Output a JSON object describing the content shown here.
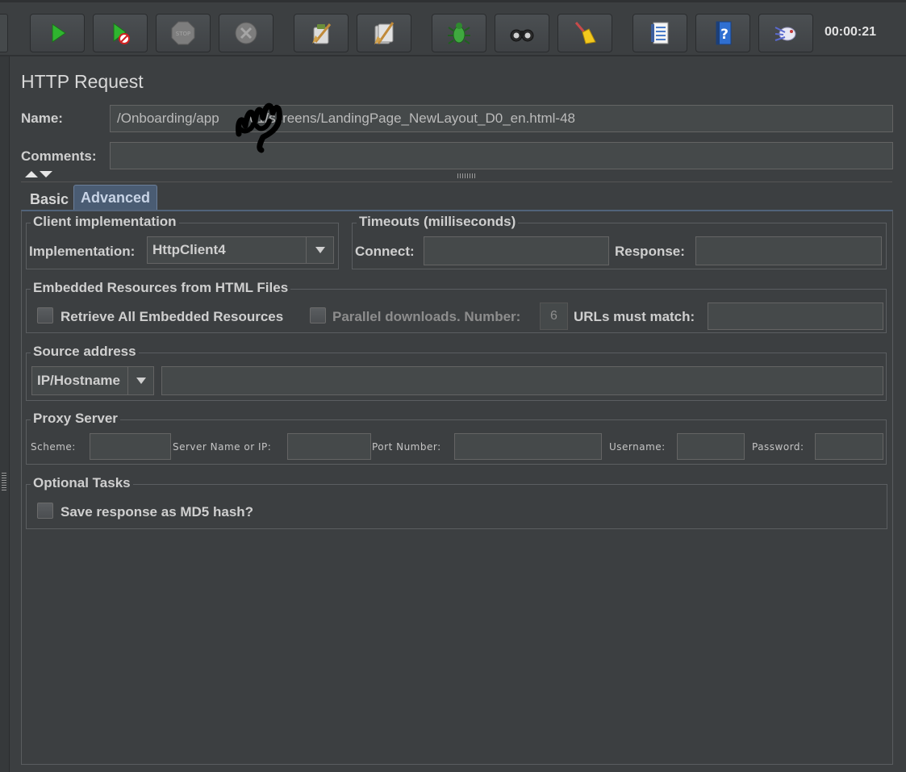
{
  "toolbar": {
    "buttons": [
      {
        "name": "start-icon"
      },
      {
        "name": "start-no-pauses-icon"
      },
      {
        "name": "stop-icon"
      },
      {
        "name": "shutdown-icon"
      },
      {
        "name": "clear-icon"
      },
      {
        "name": "clear-all-icon"
      },
      {
        "name": "bug-icon"
      },
      {
        "name": "binoculars-icon"
      },
      {
        "name": "broom-icon"
      },
      {
        "name": "function-helper-icon"
      },
      {
        "name": "help-icon"
      },
      {
        "name": "remote-icon"
      }
    ],
    "timer": "00:00:21"
  },
  "panel": {
    "title": "HTTP Request",
    "name_label": "Name:",
    "name_value": "/Onboarding/app        01/screens/LandingPage_NewLayout_D0_en.html-48",
    "comments_label": "Comments:",
    "comments_value": ""
  },
  "tabs": [
    {
      "label": "Basic",
      "active": false
    },
    {
      "label": "Advanced",
      "active": true
    }
  ],
  "client_impl": {
    "title": "Client implementation",
    "impl_label": "Implementation:",
    "impl_value": "HttpClient4"
  },
  "timeouts": {
    "title": "Timeouts (milliseconds)",
    "connect_label": "Connect:",
    "response_label": "Response:"
  },
  "embedded": {
    "title": "Embedded Resources from HTML Files",
    "retrieve_label": "Retrieve All Embedded Resources",
    "parallel_label": "Parallel downloads. Number:",
    "parallel_value": "6",
    "urls_label": "URLs must match:"
  },
  "source": {
    "title": "Source address",
    "type_value": "IP/Hostname"
  },
  "proxy": {
    "title": "Proxy Server",
    "scheme_label": "Scheme:",
    "server_label": "Server Name or IP:",
    "port_label": "Port Number:",
    "username_label": "Username:",
    "password_label": "Password:"
  },
  "optional": {
    "title": "Optional Tasks",
    "md5_label": "Save response as MD5 hash?"
  }
}
